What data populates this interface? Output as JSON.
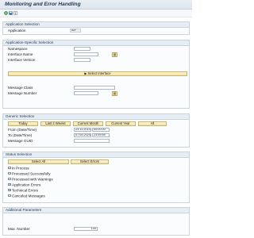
{
  "window": {
    "title": "Monitoring and Error Handling"
  },
  "toolbar": {
    "icons": [
      "execute-icon",
      "save-variant-icon",
      "info-icon"
    ]
  },
  "application_selection": {
    "heading": "Application Selection",
    "application_label": "Application",
    "application_value": "AIF"
  },
  "application_specific": {
    "heading": "Application-Specific Selection",
    "namespace_label": "Namespace",
    "namespace_value": "",
    "interface_name_label": "Interface Name",
    "interface_name_value": "",
    "interface_version_label": "Interface Version",
    "interface_version_value": "",
    "select_interface_label": "Select Interface",
    "message_class_label": "Message Class",
    "message_class_value": "",
    "message_number_label": "Message Number",
    "message_number_value": ""
  },
  "generic_selection": {
    "heading": "Generic Selection",
    "period_buttons": [
      "Today",
      "Last 2 Weeks",
      "Current Month",
      "Current Year",
      "All"
    ],
    "from_label": "From (Date/Time)",
    "from_date": "23.11.2014",
    "from_time": "00:00:00",
    "to_label": "To (Date/Time)",
    "to_date": "07.05.2024",
    "to_time": "23:59:59",
    "message_guid_label": "Message GUID",
    "message_guid_value": ""
  },
  "status_selection": {
    "heading": "Status Selection",
    "select_all_label": "Select All",
    "select_errors_label": "Select Errors",
    "options": [
      {
        "label": "In Process",
        "checked": false
      },
      {
        "label": "Processed Successfully",
        "checked": false
      },
      {
        "label": "Processed with Warnings",
        "checked": false
      },
      {
        "label": "Application Errors",
        "checked": true
      },
      {
        "label": "Technical Errors",
        "checked": true
      },
      {
        "label": "Canceled Messages",
        "checked": false
      }
    ]
  },
  "additional_parameters": {
    "heading": "Additional Parameters",
    "max_number_label": "Max. Number",
    "max_number_value": "100"
  }
}
